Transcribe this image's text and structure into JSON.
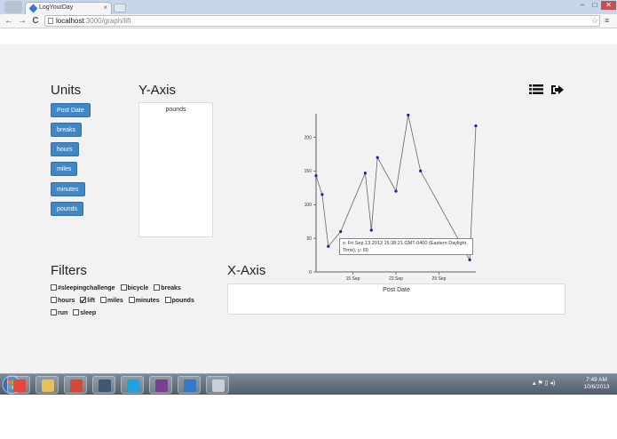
{
  "browser": {
    "tab_title": "LogYourDay",
    "tab_close": "×",
    "url_host": "localhost",
    "url_path": ":3000/graph/lift",
    "window_controls": [
      "–",
      "□",
      "✕"
    ],
    "nav": {
      "back": "←",
      "forward": "→",
      "reload": "C"
    },
    "star": "☆",
    "menu": "≡"
  },
  "units": {
    "heading": "Units",
    "buttons": [
      "Post Date",
      "breaks",
      "hours",
      "miles",
      "minutes",
      "pounds"
    ]
  },
  "yaxis": {
    "heading": "Y-Axis",
    "selected": "pounds"
  },
  "xaxis": {
    "heading": "X-Axis",
    "selected": "Post Date"
  },
  "filters": {
    "heading": "Filters",
    "rows": [
      [
        {
          "label": "#sleepingchallenge",
          "checked": false
        },
        {
          "label": "bicycle",
          "checked": false
        },
        {
          "label": "breaks",
          "checked": false
        }
      ],
      [
        {
          "label": "hours",
          "checked": false
        },
        {
          "label": "lift",
          "checked": true
        },
        {
          "label": "miles",
          "checked": false
        },
        {
          "label": "minutes",
          "checked": false
        },
        {
          "label": "pounds",
          "checked": false
        }
      ],
      [
        {
          "label": "run",
          "checked": false
        },
        {
          "label": "sleep",
          "checked": false
        }
      ]
    ]
  },
  "chart_data": {
    "type": "line",
    "x": [
      "2013-09-09",
      "2013-09-10",
      "2013-09-11",
      "2013-09-13",
      "2013-09-17",
      "2013-09-18",
      "2013-09-19",
      "2013-09-22",
      "2013-09-24",
      "2013-09-26",
      "2013-10-04",
      "2013-10-05"
    ],
    "values": [
      143,
      115,
      38,
      60,
      147,
      62,
      170,
      120,
      233,
      150,
      18,
      217
    ],
    "xtick_labels": [
      "15 Sep",
      "22 Sep",
      "29 Sep"
    ],
    "xtick_dates": [
      "2013-09-15",
      "2013-09-22",
      "2013-09-29"
    ],
    "yticks": [
      0,
      50,
      100,
      150,
      200
    ],
    "xlim": [
      "2013-09-09",
      "2013-10-05"
    ],
    "ylim": [
      0,
      235
    ],
    "line_color": "#666666",
    "point_color": "#1f1fa8",
    "tooltip": "x: Fri Sep 13 2013 15:38:21 GMT-0400 (Eastern Daylight Time), y: 60"
  },
  "taskbar": {
    "apps": [
      {
        "name": "chrome-icon",
        "color": "#e8453c"
      },
      {
        "name": "folder-icon",
        "color": "#e6c15a"
      },
      {
        "name": "git-icon",
        "color": "#d44a3a"
      },
      {
        "name": "terminal-icon",
        "color": "#3e5a73"
      },
      {
        "name": "skype-icon",
        "color": "#1fa2e0"
      },
      {
        "name": "winrar-icon",
        "color": "#7b3f8f"
      },
      {
        "name": "shark-icon",
        "color": "#3577c8"
      },
      {
        "name": "app-icon",
        "color": "#c8cfd8"
      }
    ],
    "tray": "▴ ⚑ ▯ ◂)",
    "time": "7:49 AM",
    "date": "10/6/2013"
  }
}
